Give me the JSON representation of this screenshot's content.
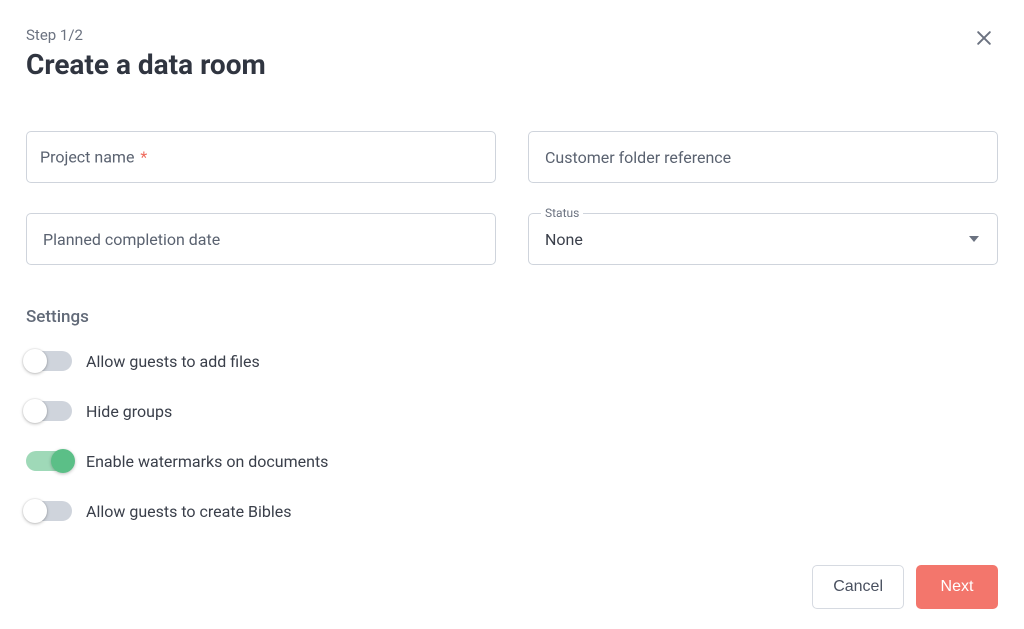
{
  "header": {
    "step": "Step 1/2",
    "title": "Create a data room"
  },
  "fields": {
    "project_name": {
      "label": "Project name",
      "required_mark": "*",
      "value": ""
    },
    "customer_folder": {
      "placeholder": "Customer folder reference",
      "value": ""
    },
    "planned_date": {
      "placeholder": "Planned completion date",
      "value": ""
    },
    "status": {
      "legend": "Status",
      "value": "None"
    }
  },
  "settings": {
    "heading": "Settings",
    "items": [
      {
        "label": "Allow guests to add files",
        "on": false
      },
      {
        "label": "Hide groups",
        "on": false
      },
      {
        "label": "Enable watermarks on documents",
        "on": true
      },
      {
        "label": "Allow guests to create Bibles",
        "on": false
      }
    ]
  },
  "footer": {
    "cancel": "Cancel",
    "next": "Next"
  }
}
